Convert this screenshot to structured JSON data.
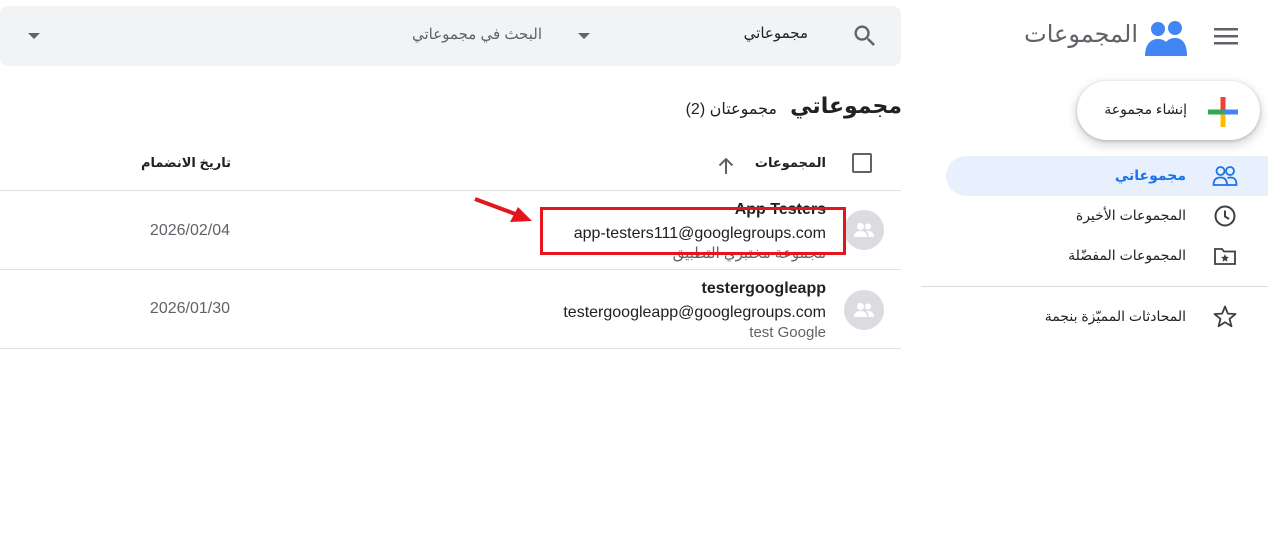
{
  "app": {
    "title": "المجموعات"
  },
  "search": {
    "scope_label": "مجموعاتي",
    "placeholder": "البحث في مجموعاتي"
  },
  "sidebar": {
    "create_label": "إنشاء مجموعة",
    "items": [
      {
        "label": "مجموعاتي",
        "icon": "people-icon",
        "active": true
      },
      {
        "label": "المجموعات الأخيرة",
        "icon": "clock-icon",
        "active": false
      },
      {
        "label": "المجموعات المفضّلة",
        "icon": "star-folder-icon",
        "active": false
      },
      {
        "label": "المحادثات المميّزة بنجمة",
        "icon": "star-icon",
        "active": false
      }
    ]
  },
  "main": {
    "title": "مجموعاتي",
    "count_label": "مجموعتان (2)",
    "columns": {
      "groups": "المجموعات",
      "joined": "تاريخ الانضمام"
    },
    "rows": [
      {
        "name": "App Testers",
        "email": "app-testers111@googlegroups.com",
        "description": "مجموعة مختبري التطبيق",
        "joined": "2026/02/04"
      },
      {
        "name": "testergoogleapp",
        "email": "testergoogleapp@googlegroups.com",
        "description": "test Google",
        "joined": "2026/01/30"
      }
    ]
  },
  "colors": {
    "accent": "#1a73e8",
    "active_bg": "#e8f0fe",
    "annotation": "#e3161e",
    "search_bg": "#f1f3f4"
  }
}
